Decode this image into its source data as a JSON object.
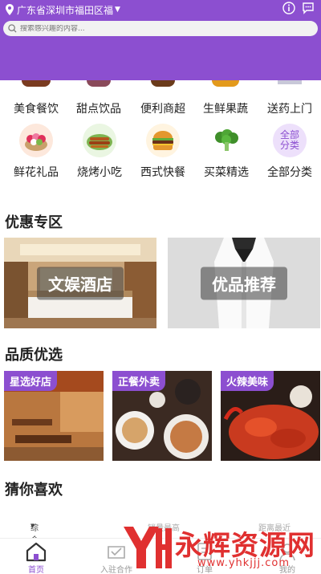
{
  "header": {
    "location": "广东省深圳市福田区福",
    "search_placeholder": "搜索感兴趣的内容..."
  },
  "categories_row1": [
    {
      "label": "美食餐饮",
      "icon": "food-icon"
    },
    {
      "label": "甜点饮品",
      "icon": "dessert-icon"
    },
    {
      "label": "便利商超",
      "icon": "store-icon"
    },
    {
      "label": "生鲜果蔬",
      "icon": "fruit-icon"
    },
    {
      "label": "送药上门",
      "icon": "medicine-icon"
    }
  ],
  "categories_row2": [
    {
      "label": "鲜花礼品",
      "icon": "flower-icon"
    },
    {
      "label": "烧烤小吃",
      "icon": "bbq-icon"
    },
    {
      "label": "西式快餐",
      "icon": "burger-icon"
    },
    {
      "label": "买菜精选",
      "icon": "vegetable-icon"
    },
    {
      "label": "全部分类",
      "icon_text": "全部分类"
    }
  ],
  "sections": {
    "promo_title": "优惠专区",
    "quality_title": "品质优选",
    "guess_title": "猜你喜欢"
  },
  "promos": [
    "文娱酒店",
    "优品推荐"
  ],
  "quality": [
    "星选好店",
    "正餐外卖",
    "火辣美味"
  ],
  "sort": {
    "comprehensive": "综合排序",
    "sales": "销量最高",
    "distance": "距离最近"
  },
  "tabs": [
    "首页",
    "入驻合作",
    "订单",
    "我的"
  ],
  "watermark": {
    "brand": "永辉资源网",
    "url": "www.yhkjjj.com"
  },
  "colors": {
    "accent": "#8c4fd0",
    "watermark": "#e03030"
  }
}
